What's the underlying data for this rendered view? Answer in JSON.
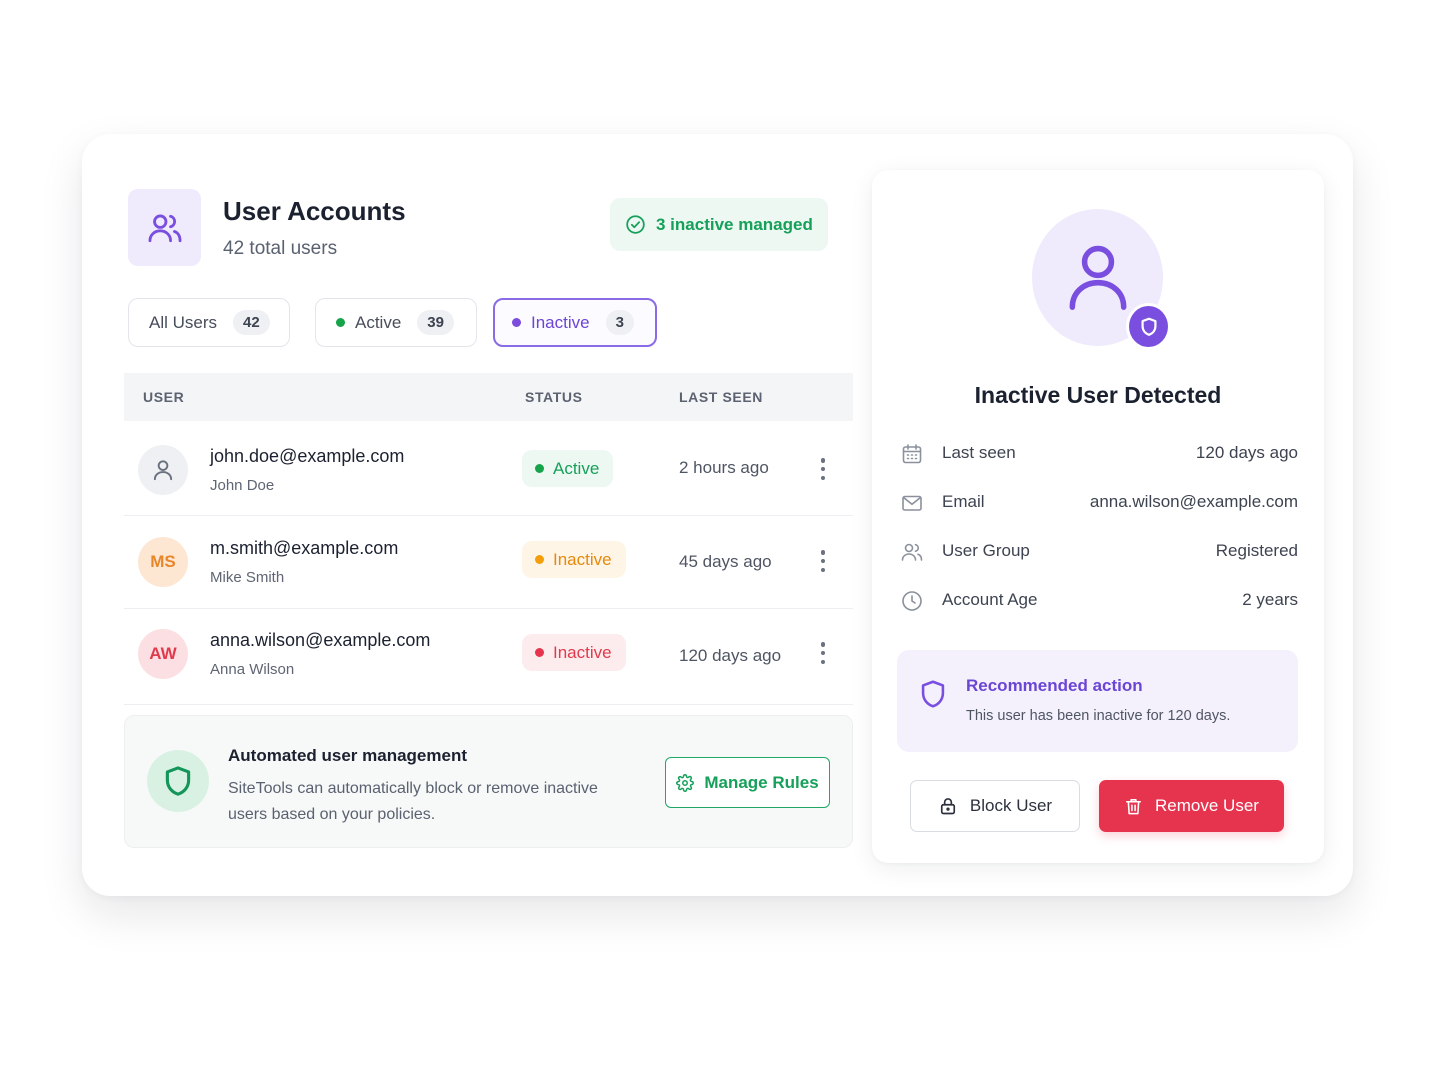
{
  "header": {
    "title": "User Accounts",
    "subtitle": "42 total users",
    "managed_label": "3 inactive managed"
  },
  "filters": [
    {
      "label": "All Users",
      "count": "42"
    },
    {
      "label": "Active",
      "count": "39",
      "dot_color": "#16a34a"
    },
    {
      "label": "Inactive",
      "count": "3",
      "dot_color": "#7c4ddc",
      "selected": true
    }
  ],
  "table": {
    "columns": [
      "USER",
      "STATUS",
      "LAST SEEN"
    ],
    "rows": [
      {
        "email": "john.doe@example.com",
        "name": "John Doe",
        "initials": "",
        "status": "Active",
        "last_seen": "2 hours ago",
        "avatar_icon": "user-icon"
      },
      {
        "email": "m.smith@example.com",
        "name": "Mike Smith",
        "initials": "MS",
        "status": "Inactive",
        "last_seen": "45 days ago"
      },
      {
        "email": "anna.wilson@example.com",
        "name": "Anna Wilson",
        "initials": "AW",
        "status": "Inactive",
        "last_seen": "120 days ago"
      }
    ]
  },
  "automation": {
    "title": "Automated user management",
    "description": "SiteTools can automatically block or remove inactive users based on your policies.",
    "button_label": "Manage Rules"
  },
  "detail": {
    "title": "Inactive User Detected",
    "fields": [
      {
        "label": "Last seen",
        "value": "120 days ago",
        "icon": "calendar-icon"
      },
      {
        "label": "Email",
        "value": "anna.wilson@example.com",
        "icon": "mail-icon"
      },
      {
        "label": "User Group",
        "value": "Registered",
        "icon": "users-icon"
      },
      {
        "label": "Account Age",
        "value": "2 years",
        "icon": "clock-icon"
      }
    ],
    "recommendation": {
      "title": "Recommended action",
      "description": "This user has been inactive for 120 days."
    },
    "block_label": "Block User",
    "remove_label": "Remove User"
  },
  "colors": {
    "accent": "#7a4fe0",
    "success": "#16a05a",
    "warning": "#f59e0b",
    "danger": "#e6344f"
  }
}
